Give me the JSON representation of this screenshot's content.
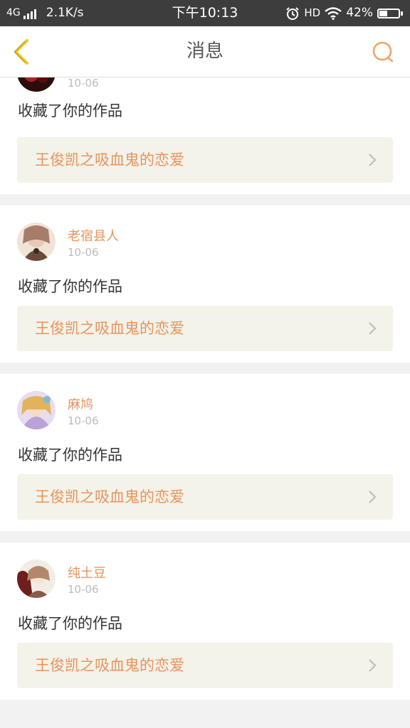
{
  "status_bar": {
    "network": "4G",
    "speed": "2.1K/s",
    "time": "下午10:13",
    "hd": "HD",
    "battery": "42%",
    "battery_level": 0.42
  },
  "header": {
    "title": "消息",
    "back_icon": "chevron-left-icon",
    "search_icon": "search-icon",
    "accent_color": "#f0a463"
  },
  "messages": [
    {
      "user": "",
      "date": "10-06",
      "action": "收藏了你的作品",
      "work": "王俊凯之吸血鬼的恋爱"
    },
    {
      "user": "老宿县人",
      "date": "10-06",
      "action": "收藏了你的作品",
      "work": "王俊凯之吸血鬼的恋爱"
    },
    {
      "user": "麻鸠",
      "date": "10-06",
      "action": "收藏了你的作品",
      "work": "王俊凯之吸血鬼的恋爱"
    },
    {
      "user": "纯土豆",
      "date": "10-06",
      "action": "收藏了你的作品",
      "work": "王俊凯之吸血鬼的恋爱"
    }
  ],
  "colors": {
    "name": "#e8935c",
    "date": "#bbbbbb",
    "work_bg": "#f3f3ea",
    "page_bg": "#f2f2f2"
  }
}
